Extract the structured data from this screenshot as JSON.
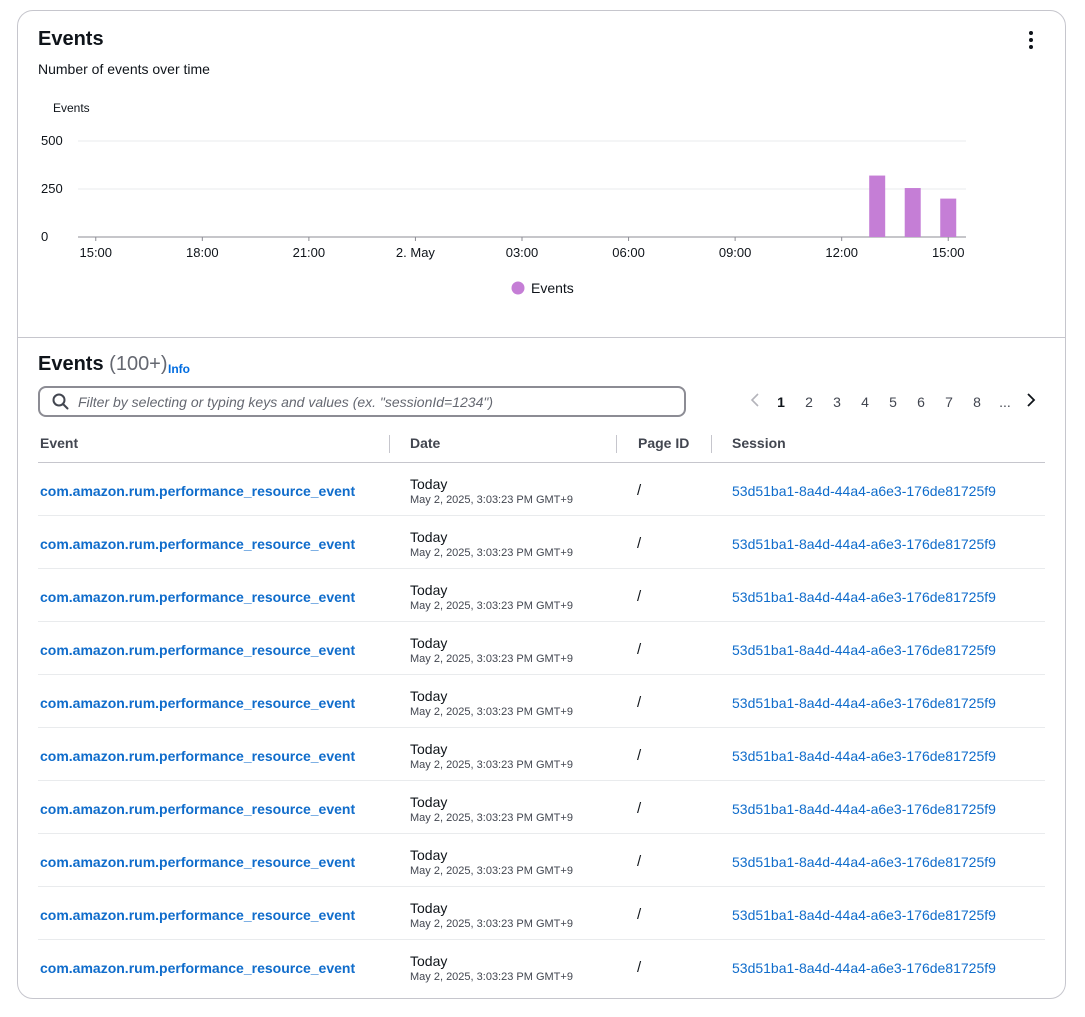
{
  "panel": {
    "title": "Events",
    "description": "Number of events over time",
    "menu_icon": "kebab-vertical-icon"
  },
  "chart_data": {
    "type": "bar",
    "title": "",
    "ylabel": "Events",
    "xlabel": "",
    "ylim": [
      0,
      500
    ],
    "yticks": [
      0,
      250,
      500
    ],
    "x_tick_labels": [
      "15:00",
      "18:00",
      "21:00",
      "2. May",
      "03:00",
      "06:00",
      "09:00",
      "12:00",
      "15:00"
    ],
    "x_tick_hours": [
      0,
      3,
      6,
      9,
      12,
      15,
      18,
      21,
      24
    ],
    "x_range_hours": [
      -0.5,
      24.5
    ],
    "grid": true,
    "legend_position": "bottom-center",
    "series": [
      {
        "name": "Events",
        "color": "#c57ed6",
        "x_labels": [
          "13:00",
          "14:00",
          "15:00"
        ],
        "x_hours": [
          22,
          23,
          24
        ],
        "values": [
          320,
          255,
          200
        ]
      }
    ]
  },
  "table": {
    "title": "Events",
    "count": "(100+)",
    "info_label": "Info",
    "filter_placeholder": "Filter by selecting or typing keys and values (ex. \"sessionId=1234\")",
    "filter_value": "",
    "search_icon": "search-icon",
    "pagination": {
      "prev_icon": "chevron-left-icon",
      "next_icon": "chevron-right-icon",
      "pages": [
        "1",
        "2",
        "3",
        "4",
        "5",
        "6",
        "7",
        "8"
      ],
      "current": "1",
      "ellipsis": "..."
    },
    "columns": [
      "Event",
      "Date",
      "Page ID",
      "Session"
    ],
    "rows": [
      {
        "event": "com.amazon.rum.performance_resource_event",
        "date_relative": "Today",
        "date_absolute": "May 2, 2025, 3:03:23 PM GMT+9",
        "page_id": "/",
        "session": "53d51ba1-8a4d-44a4-a6e3-176de81725f9"
      },
      {
        "event": "com.amazon.rum.performance_resource_event",
        "date_relative": "Today",
        "date_absolute": "May 2, 2025, 3:03:23 PM GMT+9",
        "page_id": "/",
        "session": "53d51ba1-8a4d-44a4-a6e3-176de81725f9"
      },
      {
        "event": "com.amazon.rum.performance_resource_event",
        "date_relative": "Today",
        "date_absolute": "May 2, 2025, 3:03:23 PM GMT+9",
        "page_id": "/",
        "session": "53d51ba1-8a4d-44a4-a6e3-176de81725f9"
      },
      {
        "event": "com.amazon.rum.performance_resource_event",
        "date_relative": "Today",
        "date_absolute": "May 2, 2025, 3:03:23 PM GMT+9",
        "page_id": "/",
        "session": "53d51ba1-8a4d-44a4-a6e3-176de81725f9"
      },
      {
        "event": "com.amazon.rum.performance_resource_event",
        "date_relative": "Today",
        "date_absolute": "May 2, 2025, 3:03:23 PM GMT+9",
        "page_id": "/",
        "session": "53d51ba1-8a4d-44a4-a6e3-176de81725f9"
      },
      {
        "event": "com.amazon.rum.performance_resource_event",
        "date_relative": "Today",
        "date_absolute": "May 2, 2025, 3:03:23 PM GMT+9",
        "page_id": "/",
        "session": "53d51ba1-8a4d-44a4-a6e3-176de81725f9"
      },
      {
        "event": "com.amazon.rum.performance_resource_event",
        "date_relative": "Today",
        "date_absolute": "May 2, 2025, 3:03:23 PM GMT+9",
        "page_id": "/",
        "session": "53d51ba1-8a4d-44a4-a6e3-176de81725f9"
      },
      {
        "event": "com.amazon.rum.performance_resource_event",
        "date_relative": "Today",
        "date_absolute": "May 2, 2025, 3:03:23 PM GMT+9",
        "page_id": "/",
        "session": "53d51ba1-8a4d-44a4-a6e3-176de81725f9"
      },
      {
        "event": "com.amazon.rum.performance_resource_event",
        "date_relative": "Today",
        "date_absolute": "May 2, 2025, 3:03:23 PM GMT+9",
        "page_id": "/",
        "session": "53d51ba1-8a4d-44a4-a6e3-176de81725f9"
      },
      {
        "event": "com.amazon.rum.performance_resource_event",
        "date_relative": "Today",
        "date_absolute": "May 2, 2025, 3:03:23 PM GMT+9",
        "page_id": "/",
        "session": "53d51ba1-8a4d-44a4-a6e3-176de81725f9"
      }
    ]
  }
}
